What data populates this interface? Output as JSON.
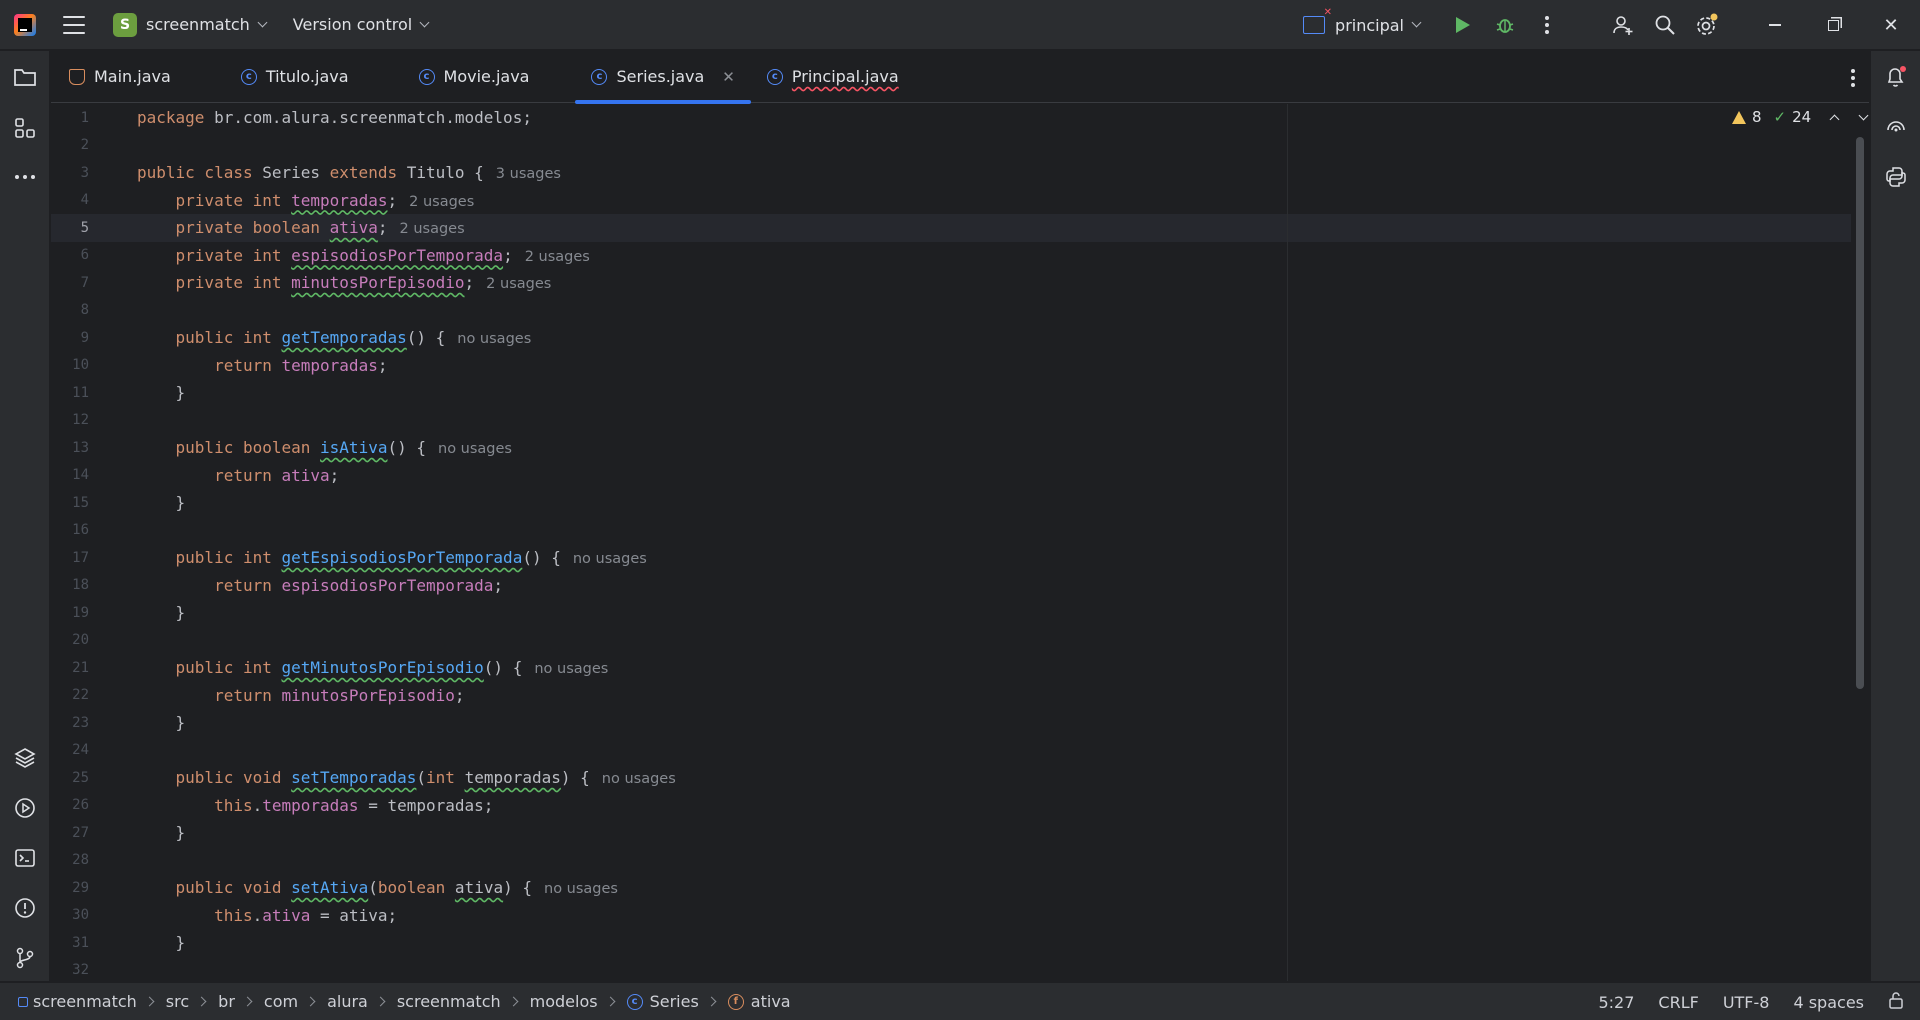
{
  "titlebar": {
    "project_initial": "S",
    "project_name": "screenmatch",
    "vcs_label": "Version control",
    "branch": "principal"
  },
  "tabs": [
    {
      "label": "Main.java",
      "icon": "java-class-icon"
    },
    {
      "label": "Titulo.java",
      "icon": "class-icon"
    },
    {
      "label": "Movie.java",
      "icon": "class-icon"
    },
    {
      "label": "Series.java",
      "icon": "class-icon",
      "active": true
    },
    {
      "label": "Principal.java",
      "icon": "class-icon",
      "error": true
    }
  ],
  "inspections": {
    "warnings": "8",
    "ok": "24"
  },
  "code": {
    "l1": {
      "kw": "package",
      "rest": " br.com.alura.screenmatch.modelos;"
    },
    "l3": {
      "kw1": "public class",
      "name": " Series ",
      "kw2": "extends",
      "rest": " Titulo {",
      "hint": "3 usages"
    },
    "l4": {
      "kw": "private int",
      "field": "temporadas",
      "rest": ";",
      "hint": "2 usages"
    },
    "l5": {
      "kw": "private boolean",
      "field": "ativa",
      "rest": ";",
      "hint": "2 usages"
    },
    "l6": {
      "kw": "private int",
      "field": "espisodiosPorTemporada",
      "rest": ";",
      "hint": "2 usages"
    },
    "l7": {
      "kw": "private int",
      "field": "minutosPorEpisodio",
      "rest": ";",
      "hint": "2 usages"
    },
    "l9": {
      "kw": "public int",
      "method": "getTemporadas",
      "rest": "() {",
      "hint": "no usages"
    },
    "l10": {
      "kw": "return",
      "field": "temporadas",
      "rest": ";"
    },
    "l13": {
      "kw": "public boolean",
      "method": "isAtiva",
      "rest": "() {",
      "hint": "no usages"
    },
    "l14": {
      "kw": "return",
      "field": "ativa",
      "rest": ";"
    },
    "l17": {
      "kw": "public int",
      "method": "getEspisodiosPorTemporada",
      "rest": "() {",
      "hint": "no usages"
    },
    "l18": {
      "kw": "return",
      "field": "espisodiosPorTemporada",
      "rest": ";"
    },
    "l21": {
      "kw": "public int",
      "method": "getMinutosPorEpisodio",
      "rest": "() {",
      "hint": "no usages"
    },
    "l22": {
      "kw": "return",
      "field": "minutosPorEpisodio",
      "rest": ";"
    },
    "l25": {
      "kw": "public void",
      "method": "setTemporadas",
      "p1": "(",
      "ptype": "int",
      "pname": "temporadas",
      "rest": ") {",
      "hint": "no usages"
    },
    "l26": {
      "kw": "this",
      "field": "temporadas",
      "rest": " = temporadas;"
    },
    "l29": {
      "kw": "public void",
      "method": "setAtiva",
      "p1": "(",
      "ptype": "boolean",
      "pname": "ativa",
      "rest": ") {",
      "hint": "no usages"
    },
    "l30": {
      "kw": "this",
      "field": "ativa",
      "rest": " = ativa;"
    },
    "close": "}"
  },
  "line_numbers": [
    "1",
    "2",
    "3",
    "4",
    "5",
    "6",
    "7",
    "8",
    "9",
    "10",
    "11",
    "12",
    "13",
    "14",
    "15",
    "16",
    "17",
    "18",
    "19",
    "20",
    "21",
    "22",
    "23",
    "24",
    "25",
    "26",
    "27",
    "28",
    "29",
    "30",
    "31",
    "32"
  ],
  "current_line": 5,
  "breadcrumb": [
    "screenmatch",
    "src",
    "br",
    "com",
    "alura",
    "screenmatch",
    "modelos",
    "Series",
    "ativa"
  ],
  "status": {
    "position": "5:27",
    "line_sep": "CRLF",
    "encoding": "UTF-8",
    "indent": "4 spaces"
  },
  "colors": {
    "accent": "#3574f0",
    "keyword": "#cf8e6d",
    "field": "#c77dbb",
    "method": "#56a8f5",
    "run": "#5fb865"
  }
}
